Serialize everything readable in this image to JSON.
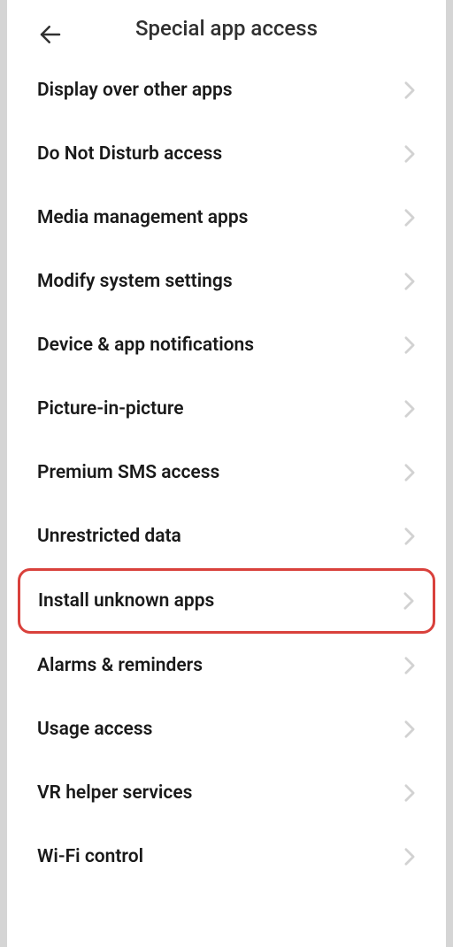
{
  "header": {
    "title": "Special app access"
  },
  "items": [
    {
      "label": "Display over other apps",
      "highlighted": false
    },
    {
      "label": "Do Not Disturb access",
      "highlighted": false
    },
    {
      "label": "Media management apps",
      "highlighted": false
    },
    {
      "label": "Modify system settings",
      "highlighted": false
    },
    {
      "label": "Device & app notifications",
      "highlighted": false
    },
    {
      "label": "Picture-in-picture",
      "highlighted": false
    },
    {
      "label": "Premium SMS access",
      "highlighted": false
    },
    {
      "label": "Unrestricted data",
      "highlighted": false
    },
    {
      "label": "Install unknown apps",
      "highlighted": true
    },
    {
      "label": "Alarms & reminders",
      "highlighted": false
    },
    {
      "label": "Usage access",
      "highlighted": false
    },
    {
      "label": "VR helper services",
      "highlighted": false
    },
    {
      "label": "Wi-Fi control",
      "highlighted": false
    }
  ]
}
